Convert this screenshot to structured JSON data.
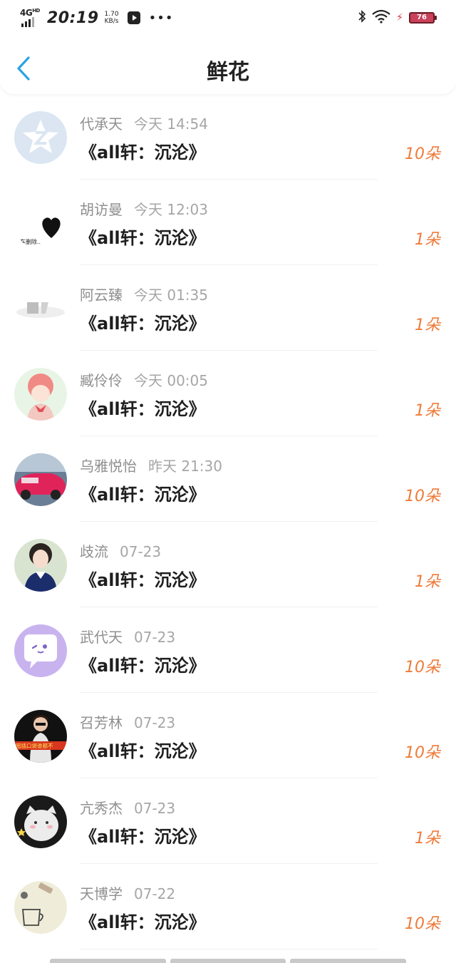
{
  "status_bar": {
    "network": "4G",
    "network_sup": "HD",
    "time": "20:19",
    "speed_value": "1.70",
    "speed_unit": "KB/s",
    "battery": "76"
  },
  "header": {
    "title": "鲜花"
  },
  "rows": [
    {
      "name": "代承天",
      "time": "今天 14:54",
      "title": "《all轩：沉沦》",
      "count": "10朵"
    },
    {
      "name": "胡访曼",
      "time": "今天 12:03",
      "title": "《all轩：沉沦》",
      "count": "1朵"
    },
    {
      "name": "阿云臻",
      "time": "今天 01:35",
      "title": "《all轩：沉沦》",
      "count": "1朵"
    },
    {
      "name": "臧伶伶",
      "time": "今天 00:05",
      "title": "《all轩：沉沦》",
      "count": "1朵"
    },
    {
      "name": "乌雅悦怡",
      "time": "昨天 21:30",
      "title": "《all轩：沉沦》",
      "count": "10朵"
    },
    {
      "name": "歧流",
      "time": "07-23",
      "title": "《all轩：沉沦》",
      "count": "1朵"
    },
    {
      "name": "武代天",
      "time": "07-23",
      "title": "《all轩：沉沦》",
      "count": "10朵"
    },
    {
      "name": "召芳林",
      "time": "07-23",
      "title": "《all轩：沉沦》",
      "count": "10朵"
    },
    {
      "name": "亢秀杰",
      "time": "07-23",
      "title": "《all轩：沉沦》",
      "count": "1朵"
    },
    {
      "name": "天博学",
      "time": "07-22",
      "title": "《all轩：沉沦》",
      "count": "10朵"
    }
  ],
  "avatar_image_text": {
    "row_1": "车删除..",
    "row_8": "暗插口袋谁都不..."
  },
  "colors": {
    "accent_blue": "#2aa3e6",
    "count_orange": "#ee7b3a",
    "meta_gray": "#8f8f8f"
  }
}
